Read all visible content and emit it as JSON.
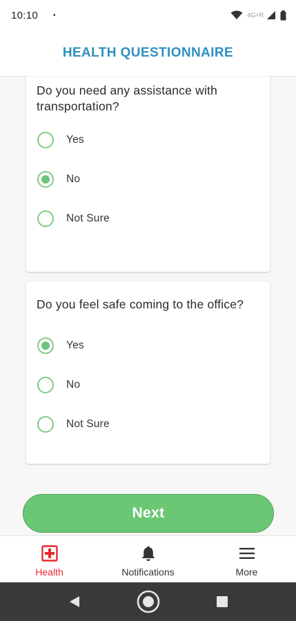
{
  "status_bar": {
    "time": "10:10",
    "dot": "•",
    "network_label": "4G+R"
  },
  "header": {
    "title": "HEALTH QUESTIONNAIRE"
  },
  "questions": [
    {
      "text": "Do you need any assistance with transportation?",
      "options": [
        {
          "label": "Yes",
          "selected": false
        },
        {
          "label": "No",
          "selected": true
        },
        {
          "label": "Not Sure",
          "selected": false
        }
      ]
    },
    {
      "text": "Do you feel safe coming to the office?",
      "options": [
        {
          "label": "Yes",
          "selected": true
        },
        {
          "label": "No",
          "selected": false
        },
        {
          "label": "Not Sure",
          "selected": false
        }
      ]
    }
  ],
  "next_button": {
    "label": "Next"
  },
  "tabbar": {
    "items": [
      {
        "label": "Health",
        "icon": "medical-cross-icon",
        "active": true
      },
      {
        "label": "Notifications",
        "icon": "bell-icon",
        "active": false
      },
      {
        "label": "More",
        "icon": "menu-icon",
        "active": false
      }
    ]
  },
  "colors": {
    "accent_blue": "#2f8fbf",
    "accent_green": "#6cc774",
    "active_tab_red": "#e8272e"
  }
}
